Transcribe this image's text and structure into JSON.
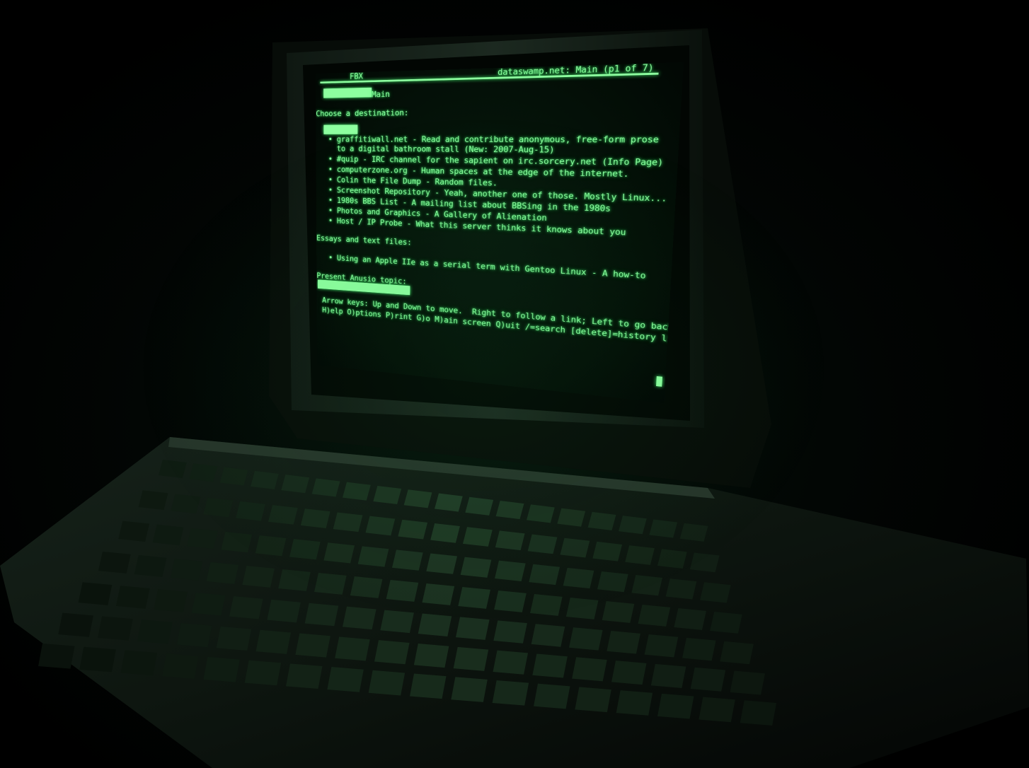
{
  "screen": {
    "title_left": "FBX",
    "title_right": "dataswamp.net: Main (p1 of 7)",
    "header_box": "",
    "header_label": "Main",
    "choose_heading": "Choose a destination:",
    "menu_highlight": "",
    "links": [
      {
        "line1": "• graffitiwall.net - Read and contribute anonymous, free-form prose",
        "line2": "  to a digital bathroom stall (New: 2007-Aug-15)"
      },
      {
        "line1": "• #quip - IRC channel for the sapient on irc.sorcery.net (Info Page)",
        "line2": ""
      },
      {
        "line1": "• computerzone.org - Human spaces at the edge of the internet.",
        "line2": ""
      },
      {
        "line1": "• Colin the File Dump - Random files.",
        "line2": ""
      },
      {
        "line1": "• Screenshot Repository - Yeah, another one of those. Mostly Linux...",
        "line2": ""
      },
      {
        "line1": "• 1980s BBS List - A mailing list about BBSing in the 1980s",
        "line2": ""
      },
      {
        "line1": "• Photos and Graphics - A Gallery of Alienation",
        "line2": ""
      },
      {
        "line1": "• Host / IP Probe - What this server thinks it knows about you",
        "line2": ""
      }
    ],
    "essays_heading": "Essays and text files:",
    "essays": [
      "• Using an Apple IIe as a serial term with Gentoo Linux - A how-to"
    ],
    "present_heading": "Present Anusio topic:",
    "present_highlight": "",
    "status_line1": "Arrow keys: Up and Down to move.  Right to follow a link; Left to go back.",
    "status_line2": "H)elp O)ptions P)rint G)o M)ain screen Q)uit /=search [delete]=history list"
  },
  "colors": {
    "phosphor": "#8dff9f",
    "phosphor_glow": "#46ff74",
    "screen_bg": "#030d06",
    "bezel": "#1a231d",
    "keyboard": "#121a14",
    "key_lit": "#2f4a36"
  }
}
